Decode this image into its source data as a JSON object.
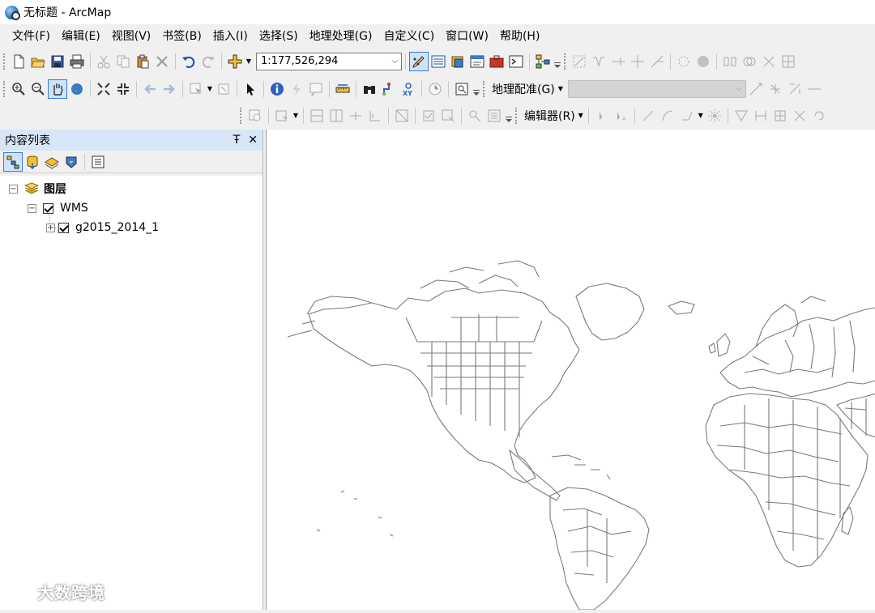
{
  "window": {
    "title": "无标题 - ArcMap"
  },
  "menu": {
    "items": [
      "文件(F)",
      "编辑(E)",
      "视图(V)",
      "书签(B)",
      "插入(I)",
      "选择(S)",
      "地理处理(G)",
      "自定义(C)",
      "窗口(W)",
      "帮助(H)"
    ]
  },
  "toolbar": {
    "scale_value": "1:177,526,294"
  },
  "georeferencing": {
    "label": "地理配准(G)"
  },
  "editor": {
    "label": "编辑器(R)"
  },
  "toc": {
    "title": "内容列表",
    "pin_glyph": "Ŧ",
    "close_glyph": "✕",
    "root_label": "图层",
    "wms_label": "WMS",
    "layer_label": "g2015_2014_1"
  },
  "watermark": {
    "text": "大数跨境"
  },
  "colors": {
    "toc_header": "#d6e6f6",
    "map_stroke": "#7a7a7a",
    "accent": "#3b7bd6"
  }
}
